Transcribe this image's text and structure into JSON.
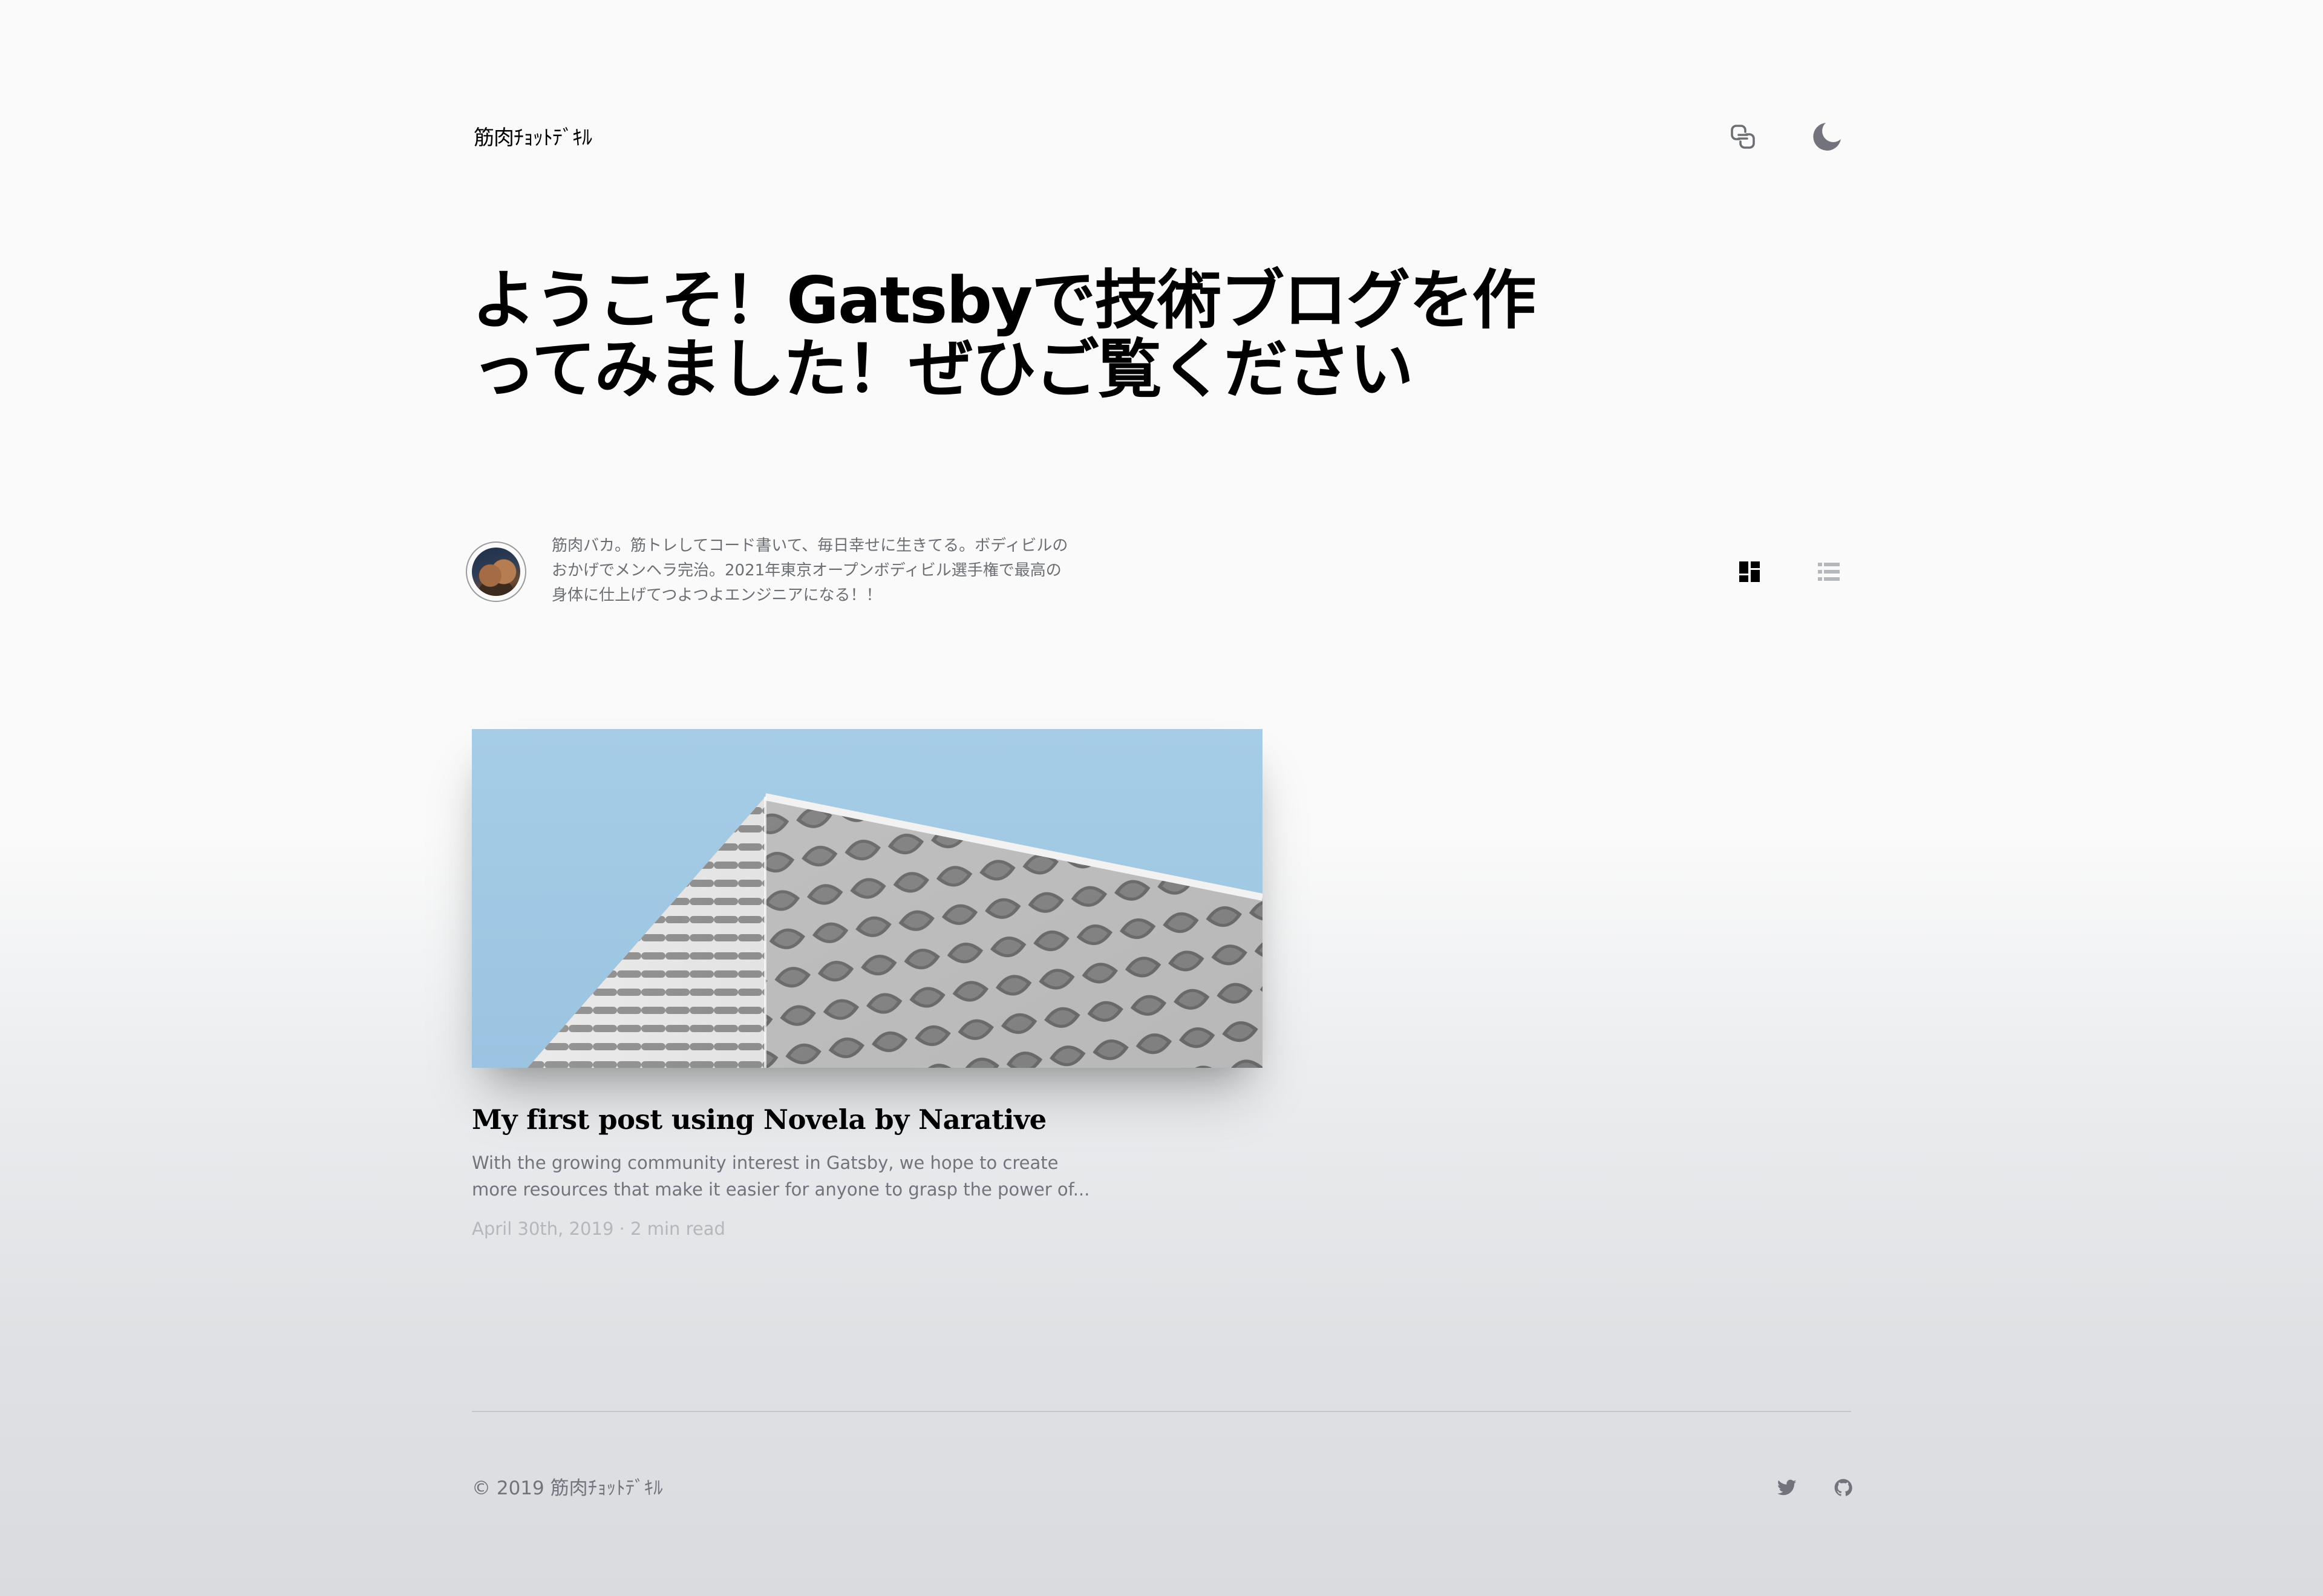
{
  "header": {
    "logo_text": "筋肉ﾁｮｯﾄﾃﾞｷﾙ",
    "share_icon": "copy-link-icon",
    "theme_icon": "moon-icon"
  },
  "hero": {
    "title": "ようこそ！Gatsbyで技術ブログを作ってみました！ぜひご覧ください"
  },
  "author": {
    "avatar_icon": "avatar",
    "bio": "筋肉バカ。筋トレしてコード書いて、毎日幸せに生きてる。ボディビルのおかげでメンヘラ完治。2021年東京オープンボディビル選手権で最高の身体に仕上げてつよつよエンジニアになる！！"
  },
  "layout_toggle": {
    "grid_icon": "grid-layout-icon",
    "rows_icon": "list-layout-icon",
    "active": "grid"
  },
  "articles": [
    {
      "title": "My first post using Novela by Narative",
      "excerpt": "With the growing community interest in Gatsby, we hope to create more resources that make it easier for anyone to grasp the power of...",
      "meta": "April 30th, 2019 · 2 min read"
    }
  ],
  "footer": {
    "copyright": "© 2019 筋肉ﾁｮｯﾄﾃﾞｷﾙ",
    "social": [
      "twitter-icon",
      "github-icon"
    ]
  },
  "colors": {
    "background": "#fafafa",
    "text_primary": "#000000",
    "text_secondary": "#73737d",
    "text_muted": "#b4b7bb",
    "sky": "#a9cfe8"
  }
}
